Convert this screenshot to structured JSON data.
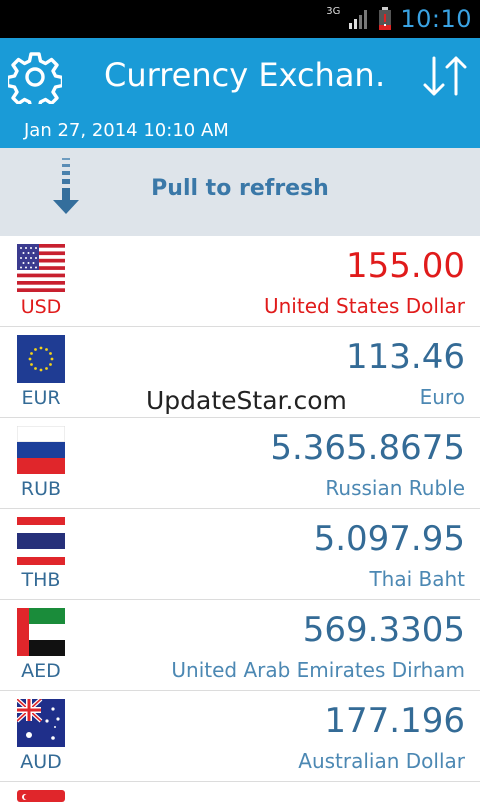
{
  "status_bar": {
    "network_type": "3G",
    "time": "10:10"
  },
  "header": {
    "title": "Currency Exchan…",
    "datetime": "Jan 27, 2014 10:10 AM"
  },
  "pull_to_refresh": {
    "label": "Pull to refresh"
  },
  "rates": [
    {
      "code": "USD",
      "amount": "155.00",
      "name": "United States Dollar",
      "flag": "us-flag-icon",
      "base": true
    },
    {
      "code": "EUR",
      "amount": "113.46",
      "name": "Euro",
      "flag": "eu-flag-icon"
    },
    {
      "code": "RUB",
      "amount": "5.365.8675",
      "name": "Russian Ruble",
      "flag": "ru-flag-icon"
    },
    {
      "code": "THB",
      "amount": "5.097.95",
      "name": "Thai Baht",
      "flag": "th-flag-icon"
    },
    {
      "code": "AED",
      "amount": "569.3305",
      "name": "United Arab Emirates Dirham",
      "flag": "ae-flag-icon"
    },
    {
      "code": "AUD",
      "amount": "177.196",
      "name": "Australian Dollar",
      "flag": "au-flag-icon"
    }
  ],
  "watermark": "UpdateStar.com",
  "colors": {
    "app_bar": "#1a9bd7",
    "base_currency": "#e01b1b",
    "rate_text": "#346b96",
    "pull_bg": "#dee4ea"
  }
}
